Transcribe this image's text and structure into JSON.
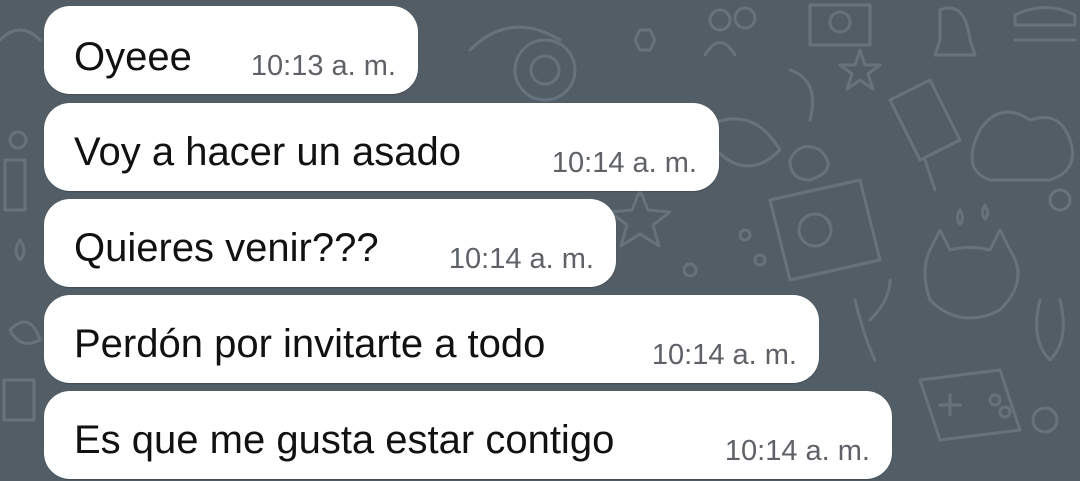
{
  "chat": {
    "messages": [
      {
        "text": "Oyeee",
        "time": "10:13 a. m."
      },
      {
        "text": "Voy a hacer un asado",
        "time": "10:14 a. m."
      },
      {
        "text": "Quieres venir???",
        "time": "10:14 a. m."
      },
      {
        "text": "Perdón por invitarte a todo",
        "time": "10:14 a. m."
      },
      {
        "text": "Es que me gusta estar contigo",
        "time": "10:14 a. m."
      }
    ]
  },
  "colors": {
    "background": "#525d66",
    "bubble": "#ffffff",
    "text": "#111111",
    "timestamp": "#5e6266",
    "doodle": "#6a747d"
  }
}
